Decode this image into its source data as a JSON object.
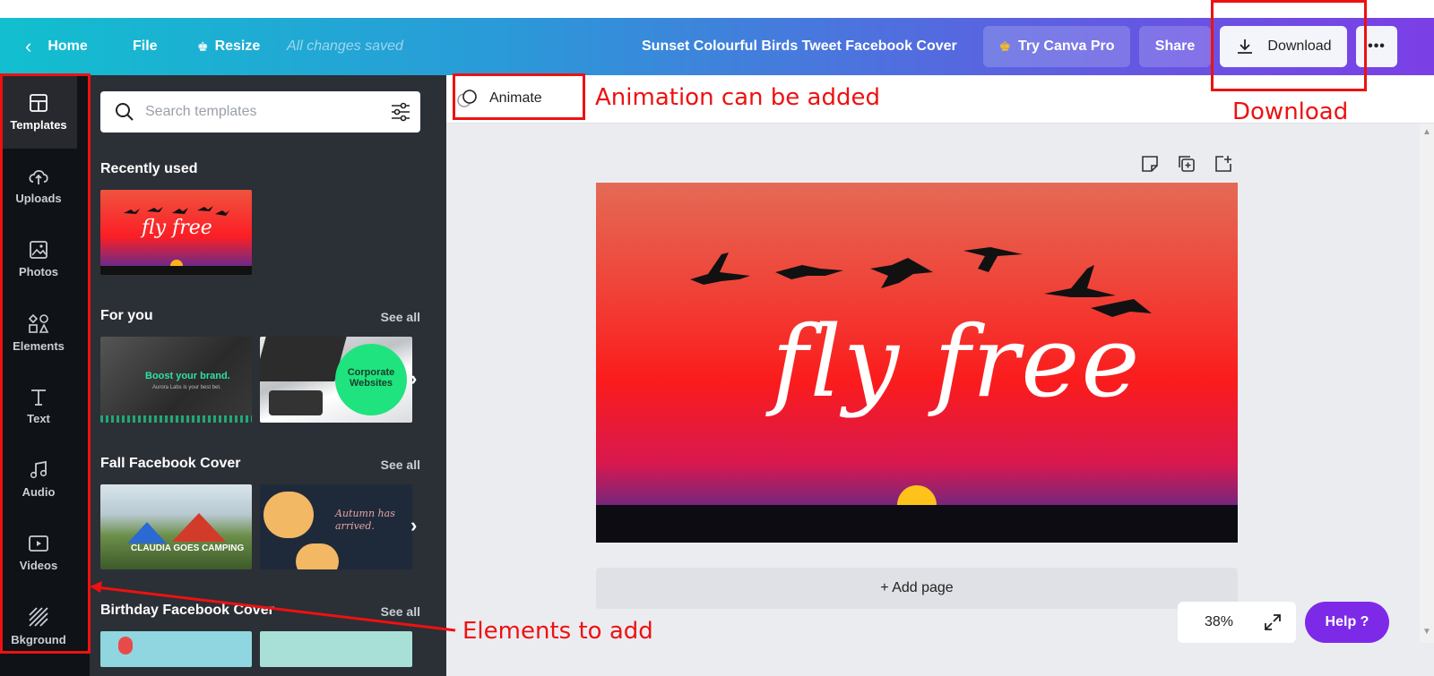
{
  "topbar": {
    "home_label": "Home",
    "file_label": "File",
    "resize_label": "Resize",
    "saved_status": "All changes saved",
    "doc_title": "Sunset Colourful Birds Tweet Facebook Cover",
    "try_pro_label": "Try Canva Pro",
    "share_label": "Share",
    "download_label": "Download",
    "more_label": "•••"
  },
  "rail": {
    "items": [
      {
        "label": "Templates",
        "icon": "templates-icon"
      },
      {
        "label": "Uploads",
        "icon": "upload-cloud-icon"
      },
      {
        "label": "Photos",
        "icon": "image-icon"
      },
      {
        "label": "Elements",
        "icon": "shapes-icon"
      },
      {
        "label": "Text",
        "icon": "text-icon"
      },
      {
        "label": "Audio",
        "icon": "music-note-icon"
      },
      {
        "label": "Videos",
        "icon": "video-play-icon"
      },
      {
        "label": "Bkground",
        "icon": "background-hatch-icon"
      }
    ]
  },
  "panel": {
    "search_placeholder": "Search templates",
    "recently_used": "Recently used",
    "sections": [
      {
        "title": "For you",
        "see_all": "See all"
      },
      {
        "title": "Fall Facebook Cover",
        "see_all": "See all"
      },
      {
        "title": "Birthday Facebook Cover",
        "see_all": "See all"
      }
    ],
    "thumbs": {
      "recent_text": "fly free",
      "boost_text": "Boost your brand.",
      "boost_sub": "Aurora Labs is your best bet.",
      "corporate_text": "Corporate Websites",
      "camping_text": "CLAUDIA GOES CAMPING",
      "autumn_text": "Autumn has arrived."
    }
  },
  "canvas": {
    "animate_label": "Animate",
    "design_text": "fly free",
    "add_page_label": "+ Add page",
    "zoom_level": "38%",
    "help_label": "Help ?"
  },
  "annotations": {
    "animation_note": "Animation can be added",
    "download_note": "Download",
    "elements_note": "Elements to add",
    "color": "#ee1111"
  },
  "colors": {
    "accent_purple": "#7d2ae8",
    "panel_dark": "#2b2f36",
    "rail_dark": "#0f1216"
  }
}
